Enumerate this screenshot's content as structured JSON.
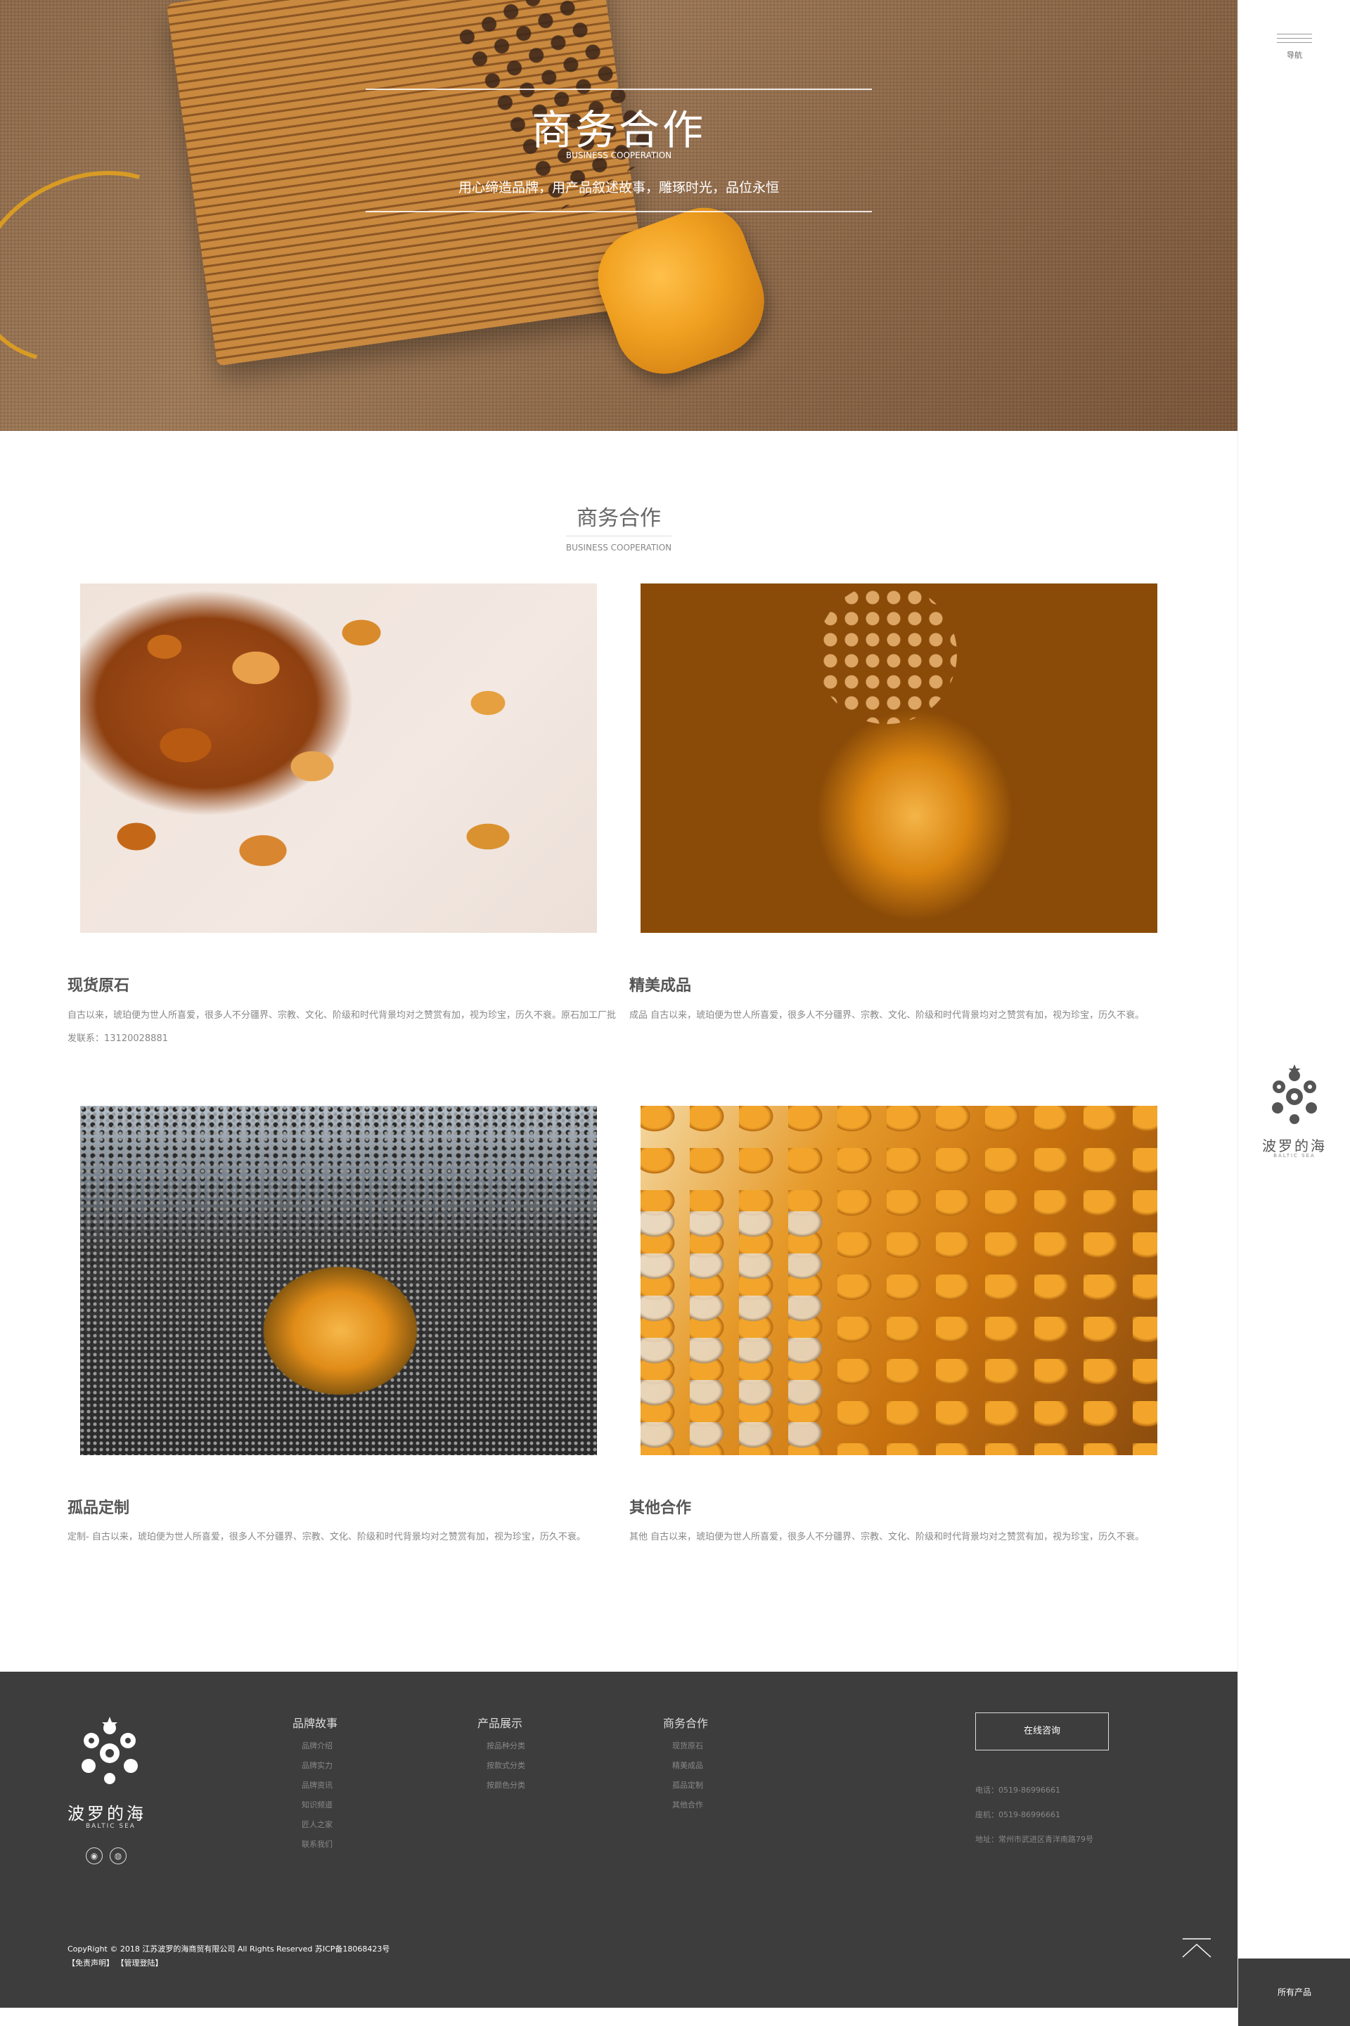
{
  "hero": {
    "title": "商务合作",
    "subtitle_en": "BUSINESS COOPERATION",
    "slogan": "用心缔造品牌，用产品叙述故事，雕琢时光，品位永恒"
  },
  "section": {
    "title": "商务合作",
    "subtitle_en": "BUSINESS COOPERATION"
  },
  "cards": [
    {
      "title": "现货原石",
      "text": "自古以来，琥珀便为世人所喜爱，很多人不分疆界、宗教、文化、阶级和时代背景均对之赞赏有加，视为珍宝，历久不衰。原石加工厂批发联系：13120028881"
    },
    {
      "title": "精美成品",
      "text": "成品 自古以来，琥珀便为世人所喜爱，很多人不分疆界、宗教、文化、阶级和时代背景均对之赞赏有加，视为珍宝，历久不衰。"
    },
    {
      "title": "孤品定制",
      "text": "定制- 自古以来，琥珀便为世人所喜爱，很多人不分疆界、宗教、文化、阶级和时代背景均对之赞赏有加，视为珍宝，历久不衰。"
    },
    {
      "title": "其他合作",
      "text": "其他 自古以来，琥珀便为世人所喜爱，很多人不分疆界、宗教、文化、阶级和时代背景均对之赞赏有加，视为珍宝，历久不衰。"
    }
  ],
  "footer": {
    "brand": "波罗的海",
    "brand_en": "BALTIC SEA",
    "social_icons": [
      "qq-icon",
      "wechat-icon"
    ],
    "columns": [
      {
        "title": "品牌故事",
        "items": [
          "品牌介绍",
          "品牌实力",
          "品牌资讯",
          "知识频道",
          "匠人之家",
          "联系我们"
        ]
      },
      {
        "title": "产品展示",
        "items": [
          "按品种分类",
          "按款式分类",
          "按颜色分类"
        ]
      },
      {
        "title": "商务合作",
        "items": [
          "现货原石",
          "精美成品",
          "孤品定制",
          "其他合作"
        ]
      }
    ],
    "consult_button": "在线咨询",
    "phone": "电话：0519-86996661",
    "fax": "座机：0519-86996661",
    "address": "地址：常州市武进区青洋南路79号",
    "copyright": "CopyRight © 2018 江苏波罗的海商贸有限公司 All Rights Reserved 苏ICP备18068423号",
    "links": "【免责声明】 【管理登陆】"
  },
  "sidebar": {
    "menu_label": "导航",
    "brand": "波罗的海",
    "brand_en": "BALTIC SEA",
    "all_products": "所有产品"
  },
  "colors": {
    "footer_bg": "#3d3d3d",
    "text_gray": "#888888",
    "title_gray": "#555555"
  }
}
